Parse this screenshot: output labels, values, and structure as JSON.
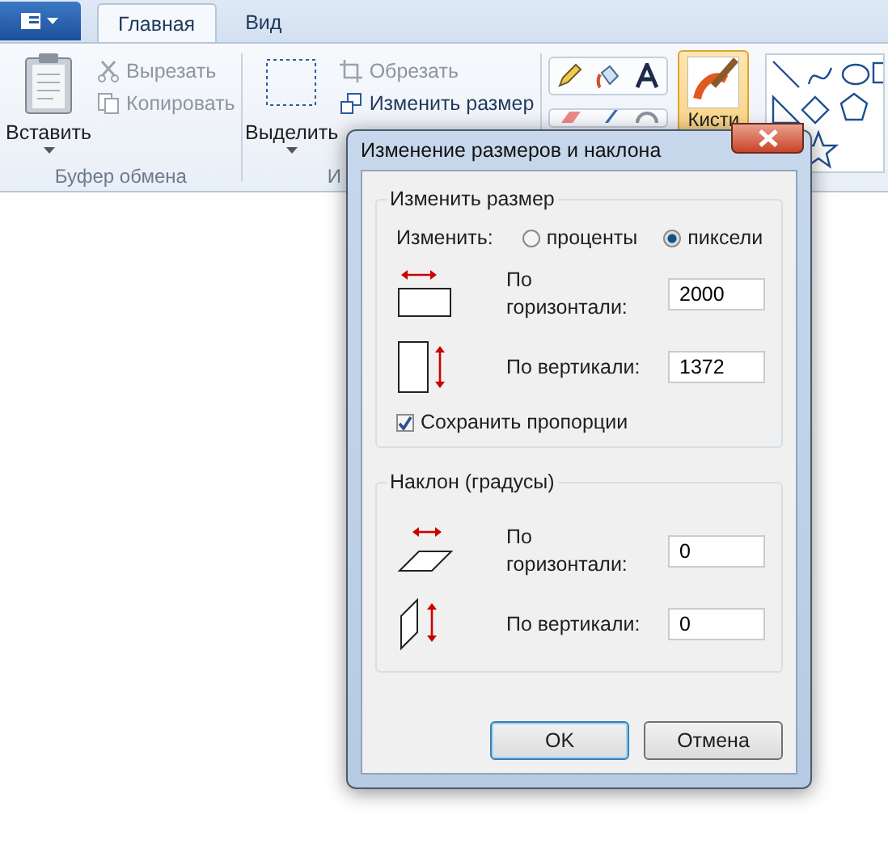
{
  "tabs": [
    {
      "label": "Главная",
      "selected": true
    },
    {
      "label": "Вид",
      "selected": false
    }
  ],
  "ribbon": {
    "groups": [
      {
        "kind": "clipboard",
        "label": "Буфер обмена",
        "big": "Вставить",
        "small": [
          {
            "kind": "cut",
            "label": "Вырезать",
            "disabled": true
          },
          {
            "kind": "copy",
            "label": "Копировать",
            "disabled": true
          }
        ]
      },
      {
        "kind": "image",
        "label": "И",
        "big": "Выделить",
        "small": [
          {
            "kind": "crop",
            "label": "Обрезать",
            "disabled": true
          },
          {
            "kind": "resize",
            "label": "Изменить размер",
            "disabled": false
          }
        ]
      }
    ],
    "brushes": {
      "label": "Кисти",
      "selected": true
    }
  },
  "dialog": {
    "title": "Изменение размеров и наклона",
    "resize": {
      "legend": "Изменить размер",
      "by_label": "Изменить:",
      "units": [
        {
          "label": "проценты",
          "selected": false
        },
        {
          "label": "пиксели",
          "selected": true
        }
      ],
      "fields": [
        {
          "kind": "horizontal",
          "label": "По горизонтали:",
          "value": "2000"
        },
        {
          "kind": "vertical",
          "label": "По вертикали:",
          "value": "1372"
        }
      ],
      "keep_ratio": {
        "label": "Сохранить пропорции",
        "checked": true
      }
    },
    "skew": {
      "legend": "Наклон (градусы)",
      "fields": [
        {
          "kind": "skew_horizontal",
          "label": "По горизонтали:",
          "value": "0"
        },
        {
          "kind": "skew_vertical",
          "label": "По вертикали:",
          "value": "0"
        }
      ]
    },
    "buttons": [
      {
        "label": "OK",
        "default": true
      },
      {
        "label": "Отмена",
        "default": false
      }
    ]
  }
}
